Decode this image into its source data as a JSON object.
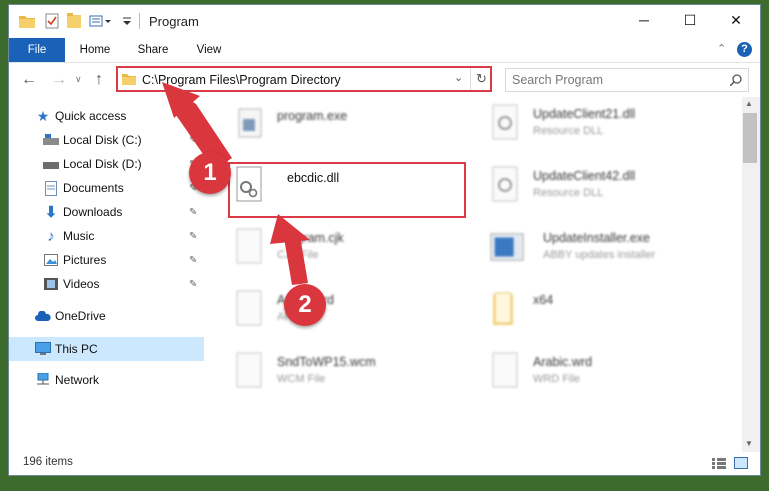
{
  "window": {
    "title": "Program",
    "minimize_glyph": "─",
    "maximize_glyph": "☐",
    "close_glyph": "✕",
    "help_glyph": "?",
    "expand_glyph": "⌃"
  },
  "ribbon": {
    "tabs": [
      "File",
      "Home",
      "Share",
      "View"
    ]
  },
  "address": {
    "path": "C:\\Program Files\\Program Directory",
    "search_placeholder": "Search Program"
  },
  "sidebar": {
    "items": [
      {
        "label": "Quick access",
        "icon": "star-icon"
      },
      {
        "label": "Local Disk (C:)",
        "icon": "drive-icon"
      },
      {
        "label": "Local Disk (D:)",
        "icon": "drive-icon"
      },
      {
        "label": "Documents",
        "icon": "documents-icon"
      },
      {
        "label": "Downloads",
        "icon": "download-icon"
      },
      {
        "label": "Music",
        "icon": "music-icon"
      },
      {
        "label": "Pictures",
        "icon": "pictures-icon"
      },
      {
        "label": "Videos",
        "icon": "videos-icon"
      },
      {
        "label": "OneDrive",
        "icon": "cloud-icon"
      },
      {
        "label": "This PC",
        "icon": "computer-icon"
      },
      {
        "label": "Network",
        "icon": "network-icon"
      }
    ]
  },
  "files": [
    {
      "name": "program.exe",
      "desc": ""
    },
    {
      "name": "UpdateClient21.dll",
      "desc": "Resource DLL"
    },
    {
      "name": "ebcdic.dll",
      "desc": ""
    },
    {
      "name": "UpdateClient42.dll",
      "desc": "Resource DLL"
    },
    {
      "name": "Program.cjk",
      "desc": "CJK File"
    },
    {
      "name": "UpdateInstaller.exe",
      "desc": "ABBY updates installer"
    },
    {
      "name": "Arabic.ard",
      "desc": "ARD File"
    },
    {
      "name": "x64",
      "desc": ""
    },
    {
      "name": "SndToWP15.wcm",
      "desc": "WCM File"
    },
    {
      "name": "Arabic.wrd",
      "desc": "WRD File"
    }
  ],
  "status": {
    "item_count": "196 items"
  },
  "annotations": {
    "step1": "1",
    "step2": "2"
  },
  "colors": {
    "accent": "#1a62b8",
    "highlight": "#dc3a44",
    "selected": "#cce8ff",
    "desktop": "#3d6b2e"
  }
}
